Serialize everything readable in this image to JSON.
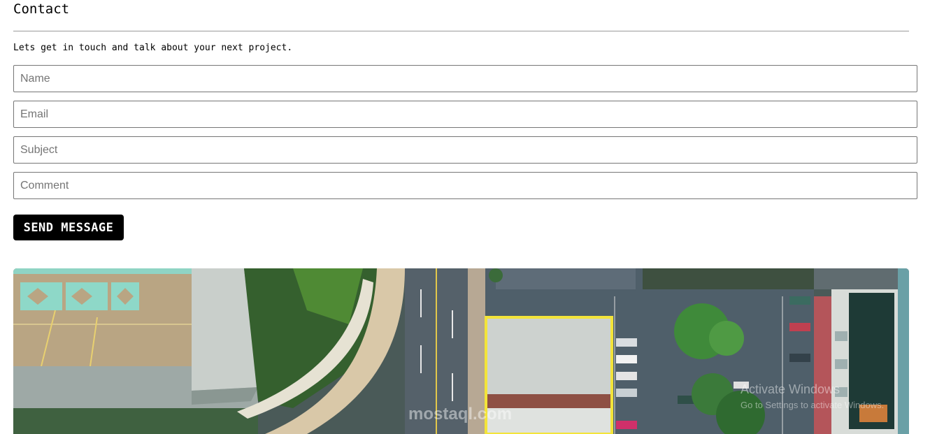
{
  "contact": {
    "title": "Contact",
    "intro": "Lets get in touch and talk about your next project.",
    "fields": {
      "name_placeholder": "Name",
      "email_placeholder": "Email",
      "subject_placeholder": "Subject",
      "comment_placeholder": "Comment"
    },
    "send_label": "SEND MESSAGE"
  },
  "image": {
    "description_icon": "aerial-city-photo",
    "watermark": "mostaql.com",
    "activation_title": "Activate Windows",
    "activation_subtitle": "Go to Settings to activate Windows."
  }
}
